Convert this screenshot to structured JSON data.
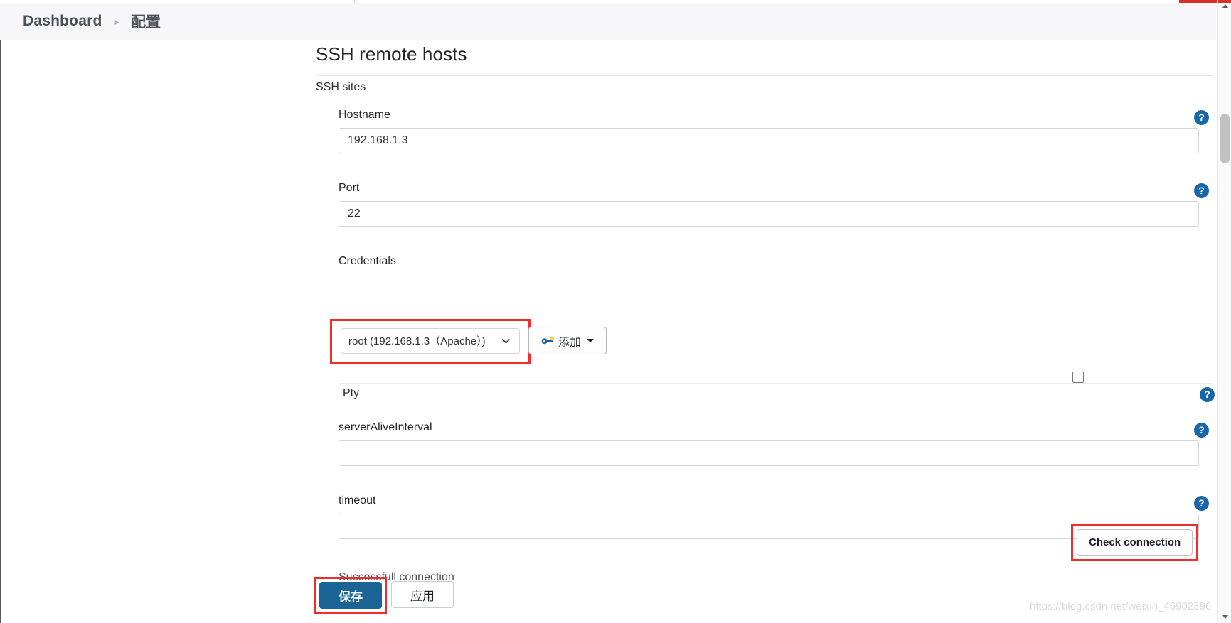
{
  "breadcrumb": {
    "root": "Dashboard",
    "separator": "▸",
    "current": "配置"
  },
  "panel": {
    "title": "SSH remote hosts",
    "section_label": "SSH sites"
  },
  "fields": {
    "hostname": {
      "label": "Hostname",
      "value": "192.168.1.3",
      "placeholder": "",
      "help": "?"
    },
    "port": {
      "label": "Port",
      "value": "22",
      "placeholder": "",
      "help": "?"
    },
    "credentials": {
      "label": "Credentials",
      "selected": "root (192.168.1.3（Apache）)",
      "options": [
        "root (192.168.1.3（Apache）)"
      ]
    },
    "pty": {
      "label": "Pty",
      "checked": false,
      "help": "?"
    },
    "server_alive_interval": {
      "label": "serverAliveInterval",
      "value": "",
      "placeholder": "",
      "help": "?"
    },
    "timeout": {
      "label": "timeout",
      "value": "",
      "placeholder": "",
      "help": "?"
    }
  },
  "buttons": {
    "add": "添加",
    "check_connection": "Check connection",
    "save": "保存",
    "apply": "应用"
  },
  "status": {
    "connection_message": "Successfull connection"
  },
  "watermark": "https://blog.csdn.net/weixin_46902396",
  "colors": {
    "accent_blue": "#1967a8",
    "save_blue": "#1a6496",
    "highlight_red": "#ef2d2d",
    "breadcrumb_bg": "#f7f7f9",
    "text_dark": "#222429"
  }
}
